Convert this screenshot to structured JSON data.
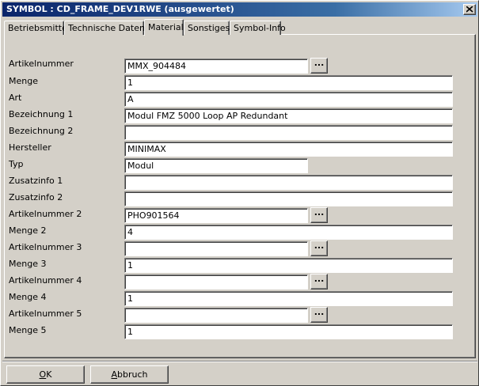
{
  "window": {
    "title": "SYMBOL : CD_FRAME_DEV1RWE  (ausgewertet)"
  },
  "tabs": [
    {
      "label": "Betriebsmittel",
      "active": false
    },
    {
      "label": "Technische Daten",
      "active": false
    },
    {
      "label": "Material",
      "active": true
    },
    {
      "label": "Sonstiges",
      "active": false
    },
    {
      "label": "Symbol-Info",
      "active": false
    }
  ],
  "fields": [
    {
      "label": "Artikelnummer",
      "value": "MMX_904484",
      "browse": true
    },
    {
      "label": "Menge",
      "value": "1",
      "browse": false
    },
    {
      "label": "Art",
      "value": "A",
      "browse": false
    },
    {
      "label": "Bezeichnung 1",
      "value": "Modul FMZ 5000 Loop AP Redundant",
      "browse": false
    },
    {
      "label": "Bezeichnung 2",
      "value": "",
      "browse": false
    },
    {
      "label": "Hersteller",
      "value": "MINIMAX",
      "browse": false
    },
    {
      "label": "Typ",
      "value": "Modul",
      "browse": false
    },
    {
      "label": "Zusatzinfo 1",
      "value": "",
      "browse": false
    },
    {
      "label": "Zusatzinfo 2",
      "value": "",
      "browse": false
    },
    {
      "label": "Artikelnummer 2",
      "value": "PHO901564",
      "browse": true
    },
    {
      "label": "Menge 2",
      "value": "4",
      "browse": false
    },
    {
      "label": "Artikelnummer 3",
      "value": "",
      "browse": true
    },
    {
      "label": "Menge 3",
      "value": "1",
      "browse": false
    },
    {
      "label": "Artikelnummer 4",
      "value": "",
      "browse": true
    },
    {
      "label": "Menge 4",
      "value": "1",
      "browse": false
    },
    {
      "label": "Artikelnummer 5",
      "value": "",
      "browse": true
    },
    {
      "label": "Menge 5",
      "value": "1",
      "browse": false
    }
  ],
  "browse_label": "...",
  "buttons": {
    "ok": {
      "mnemonic": "O",
      "rest": "K"
    },
    "cancel": {
      "mnemonic": "A",
      "rest": "bbruch"
    }
  },
  "colors": {
    "titlebar_start": "#0a246a",
    "titlebar_end": "#a6caf0",
    "face": "#d4d0c8"
  }
}
